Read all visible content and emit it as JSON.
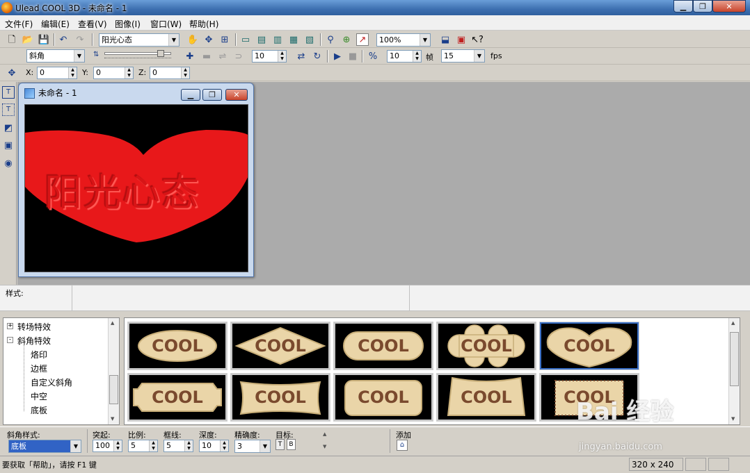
{
  "window": {
    "title": "Ulead COOL 3D - 未命名 - 1"
  },
  "menu": [
    "文件(F)",
    "编辑(E)",
    "查看(V)",
    "图像(I)",
    "窗口(W)",
    "帮助(H)"
  ],
  "toolbar1": {
    "text_combo": "阳光心态",
    "zoom": "100%"
  },
  "toolbar2": {
    "bevel_combo": "斜角",
    "value1": "10",
    "value2": "10",
    "frame_label": "帧",
    "fps_value": "15",
    "fps_label": "fps"
  },
  "toolbar3": {
    "x_label": "X:",
    "x_value": "0",
    "y_label": "Y:",
    "y_value": "0",
    "z_label": "Z:",
    "z_value": "0"
  },
  "document": {
    "title": "未命名 - 1",
    "text": "阳光心态",
    "heart_color": "#e8181a"
  },
  "style_bar": {
    "label": "样式:"
  },
  "tree": {
    "items": [
      {
        "label": "转场特效",
        "expander": "+"
      },
      {
        "label": "斜角特效",
        "expander": "-"
      },
      {
        "label": "烙印"
      },
      {
        "label": "边框"
      },
      {
        "label": "自定义斜角"
      },
      {
        "label": "中空"
      },
      {
        "label": "底板"
      }
    ]
  },
  "thumbnails": {
    "label": "COOL",
    "shapes": [
      "ellipse",
      "diamond",
      "rounded-rect",
      "cloud",
      "heart",
      "notched-rect",
      "wavy-banner",
      "rounded-square",
      "tab-banner",
      "stamp"
    ],
    "selected_index": 4,
    "fill_color": "#ead5a8",
    "text_color": "#7a4a2e"
  },
  "props": {
    "bevel_style_label": "斜角样式:",
    "bevel_style_value": "底板",
    "protrude_label": "突起:",
    "protrude_value": "100",
    "ratio_label": "比例:",
    "ratio_value": "5",
    "frame_label": "框线:",
    "frame_value": "5",
    "depth_label": "深度:",
    "depth_value": "10",
    "precision_label": "精确度:",
    "precision_value": "3",
    "target_label": "目标:",
    "target_t": "T",
    "target_b": "B",
    "add_label": "添加"
  },
  "status": {
    "help_text": "要获取「帮助」，请按 F1 键",
    "size": "320 x 240"
  },
  "watermark": {
    "main": "Bai 经验",
    "sub": "jingyan.baidu.com"
  }
}
